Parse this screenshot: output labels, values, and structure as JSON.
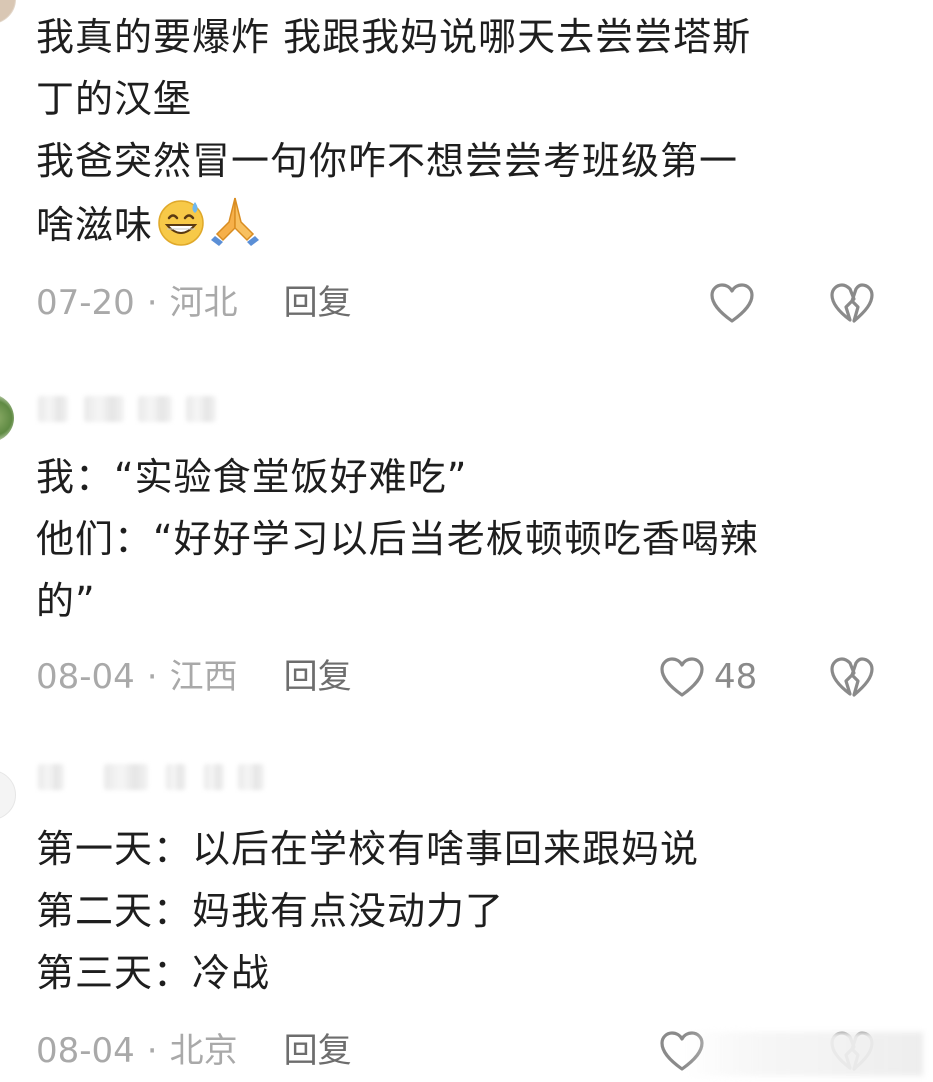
{
  "comments": [
    {
      "username": "",
      "lines": [
        "我真的要爆炸 我跟我妈说哪天去尝尝塔斯",
        "丁的汉堡",
        "我爸突然冒一句你咋不想尝尝考班级第一",
        "啥滋味"
      ],
      "emojis": [
        "grinning-sweat-emoji",
        "folded-hands-emoji"
      ],
      "date": "07-20",
      "location": "河北",
      "reply_label": "回复",
      "like_count": ""
    },
    {
      "username": "",
      "lines": [
        "我：“实验食堂饭好难吃”",
        "他们：“好好学习以后当老板顿顿吃香喝辣",
        "的”"
      ],
      "date": "08-04",
      "location": "江西",
      "reply_label": "回复",
      "like_count": "48"
    },
    {
      "username": "",
      "lines": [
        "第一天：以后在学校有啥事回来跟妈说",
        "第二天：妈我有点没动力了",
        "第三天：冷战"
      ],
      "date": "08-04",
      "location": "北京",
      "reply_label": "回复",
      "like_count": ""
    }
  ],
  "separator": "·",
  "colors": {
    "text": "#1e1e1e",
    "meta": "#a9a9a9",
    "reply": "#6d6d6d",
    "icon": "#8a8a8a"
  },
  "icons": {
    "like": "heart-outline-icon",
    "dislike": "broken-heart-outline-icon"
  }
}
